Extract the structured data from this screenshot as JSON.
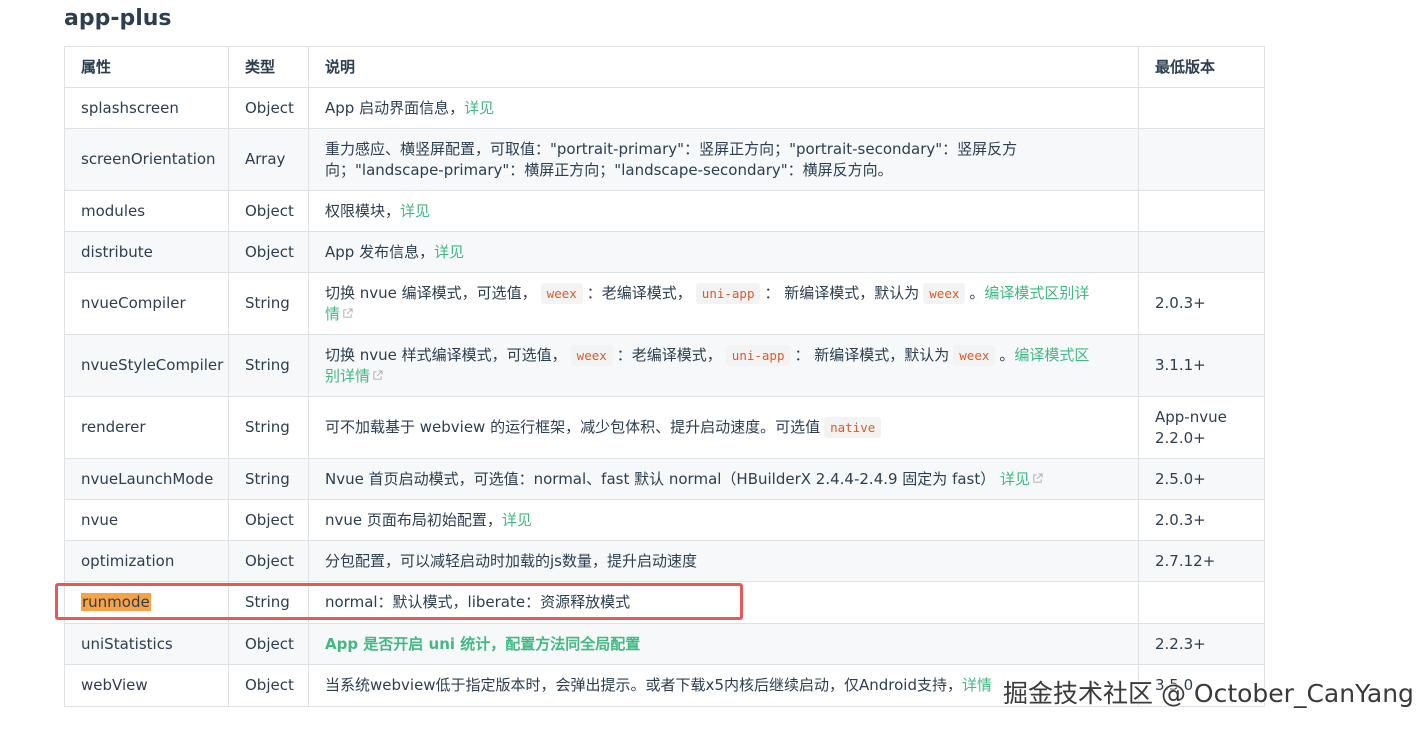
{
  "heading": "app-plus",
  "columns": [
    "属性",
    "类型",
    "说明",
    "最低版本"
  ],
  "rows": [
    {
      "prop": "splashscreen",
      "type": "Object",
      "desc_text": "App 启动界面信息，",
      "desc_link": "详见",
      "version": ""
    },
    {
      "prop": "screenOrientation",
      "type": "Array",
      "desc_line1": "重力感应、横竖屏配置，可取值：\"portrait-primary\"：竖屏正方向；\"portrait-secondary\"：竖屏反方",
      "desc_line2": "向；\"landscape-primary\"：横屏正方向；\"landscape-secondary\"：横屏反方向。",
      "version": ""
    },
    {
      "prop": "modules",
      "type": "Object",
      "desc_text": "权限模块，",
      "desc_link": "详见",
      "version": ""
    },
    {
      "prop": "distribute",
      "type": "Object",
      "desc_text": "App 发布信息，",
      "desc_link": "详见",
      "version": ""
    },
    {
      "prop": "nvueCompiler",
      "type": "String",
      "desc_a": "切换 nvue 编译模式，可选值，",
      "code1": "weex",
      "desc_b": "：老编译模式，",
      "code2": "uni-app",
      "desc_c": "： 新编译模式，默认为",
      "code3": "weex",
      "desc_d": "。",
      "link_line1": "编译模式区别详",
      "link_line2": "情",
      "version": "2.0.3+"
    },
    {
      "prop": "nvueStyleCompiler",
      "type": "String",
      "desc_a": "切换 nvue 样式编译模式，可选值，",
      "code1": "weex",
      "desc_b": "：老编译模式，",
      "code2": "uni-app",
      "desc_c": "： 新编译模式，默认为",
      "code3": "weex",
      "desc_d": "。",
      "link_line1": "编译模式区",
      "link_line2": "别详情",
      "version": "3.1.1+"
    },
    {
      "prop": "renderer",
      "type": "String",
      "desc_text": "可不加载基于 webview 的运行框架，减少包体积、提升启动速度。可选值",
      "code1": "native",
      "version_line1": "App-nvue",
      "version_line2": "2.2.0+"
    },
    {
      "prop": "nvueLaunchMode",
      "type": "String",
      "desc_text": "Nvue 首页启动模式，可选值：normal、fast 默认 normal（HBuilderX 2.4.4-2.4.9 固定为 fast）",
      "desc_link": "详见",
      "version": "2.5.0+"
    },
    {
      "prop": "nvue",
      "type": "Object",
      "desc_text": "nvue 页面布局初始配置，",
      "desc_link": "详见",
      "version": "2.0.3+"
    },
    {
      "prop": "optimization",
      "type": "Object",
      "desc_text": "分包配置，可以减轻启动时加载的js数量，提升启动速度",
      "version": "2.7.12+"
    },
    {
      "prop": "runmode",
      "type": "String",
      "desc_text": "normal：默认模式，liberate：资源释放模式",
      "version": ""
    },
    {
      "prop": "uniStatistics",
      "type": "Object",
      "desc_link": "App 是否开启 uni 统计，配置方法同全局配置",
      "version": "2.2.3+"
    },
    {
      "prop": "webView",
      "type": "Object",
      "desc_text": "当系统webview低于指定版本时，会弹出提示。或者下载x5内核后继续启动，仅Android支持，",
      "desc_link": "详情",
      "version": "3.5.0"
    }
  ],
  "watermark": "掘金技术社区 @ October_CanYang",
  "colors": {
    "link": "#42b983",
    "code": "#d95c2b",
    "highlight": "#f8a246",
    "redbox": "#e8585a"
  },
  "icons": [
    "external-link-icon"
  ]
}
